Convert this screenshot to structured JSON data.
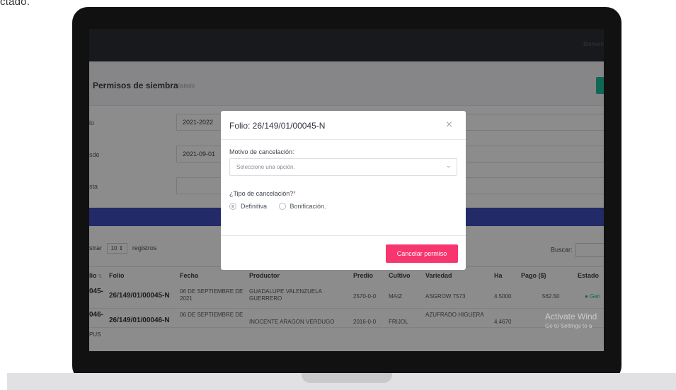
{
  "caption": "ctado.",
  "topbar": {
    "user_text": "Bienven"
  },
  "page": {
    "title": "Permisos de siembra",
    "subtitle": "listado"
  },
  "filters": [
    {
      "label": "lo",
      "value": "2021-2022"
    },
    {
      "label": "sde",
      "value": "2021-09-01"
    },
    {
      "label": "sta",
      "value": ""
    }
  ],
  "table_controls": {
    "show_prefix": "strar",
    "length_value": "10",
    "show_suffix": "registros",
    "search_label": "Buscar:"
  },
  "table": {
    "columns": [
      "lio",
      "Folio",
      "Fecha",
      "Productor",
      "Predio",
      "Cultivo",
      "Variedad",
      "Ha",
      "Pago ($)",
      "Estado"
    ],
    "rows": [
      {
        "id": "045-",
        "folio": "26/149/01/00045-N",
        "fecha": "06 DE SEPTIEMBRE DE 2021",
        "productor": "GUADALUPE VALENZUELA GUERRERO",
        "predio": "2570-0-0",
        "cultivo": "MAIZ",
        "variedad": "ASGROW 7573",
        "ha": "4.5000",
        "pago": "562.50",
        "estado": "Gen"
      },
      {
        "id": "046-",
        "folio": "26/149/01/00046-N",
        "fecha": "06 DE SEPTIEMBRE DE",
        "productor": "INOCENTE ARAGON VERDUGO",
        "predio": "2016-0-0",
        "cultivo": "FRIJOL",
        "variedad": "AZUFRADO HIGUERA",
        "ha": "4.4670",
        "pago": "",
        "estado": ""
      }
    ],
    "footer": "PUS"
  },
  "watermark": {
    "line1": "Activate Wind",
    "line2": "Go to Settings to a"
  },
  "modal": {
    "title": "Folio: 26/149/01/00045-N",
    "close_glyph": "×",
    "reason_label": "Motivo de cancelación:",
    "reason_placeholder": "Seleccione una opción.",
    "type_label": "¿Tipo de cancelación?",
    "required_mark": "*",
    "options": [
      "Definitiva",
      "Bonificación."
    ],
    "selected_option": "Definitiva",
    "submit_label": "Cancelar permiso"
  },
  "colors": {
    "accent": "#f7356f",
    "blue_band": "#3f4ebc",
    "green": "#1cbd9b",
    "topbar": "#2b2e33"
  },
  "icons": {
    "close": "close-icon",
    "chevron": "chevron-down-icon",
    "sort": "sort-icon"
  }
}
